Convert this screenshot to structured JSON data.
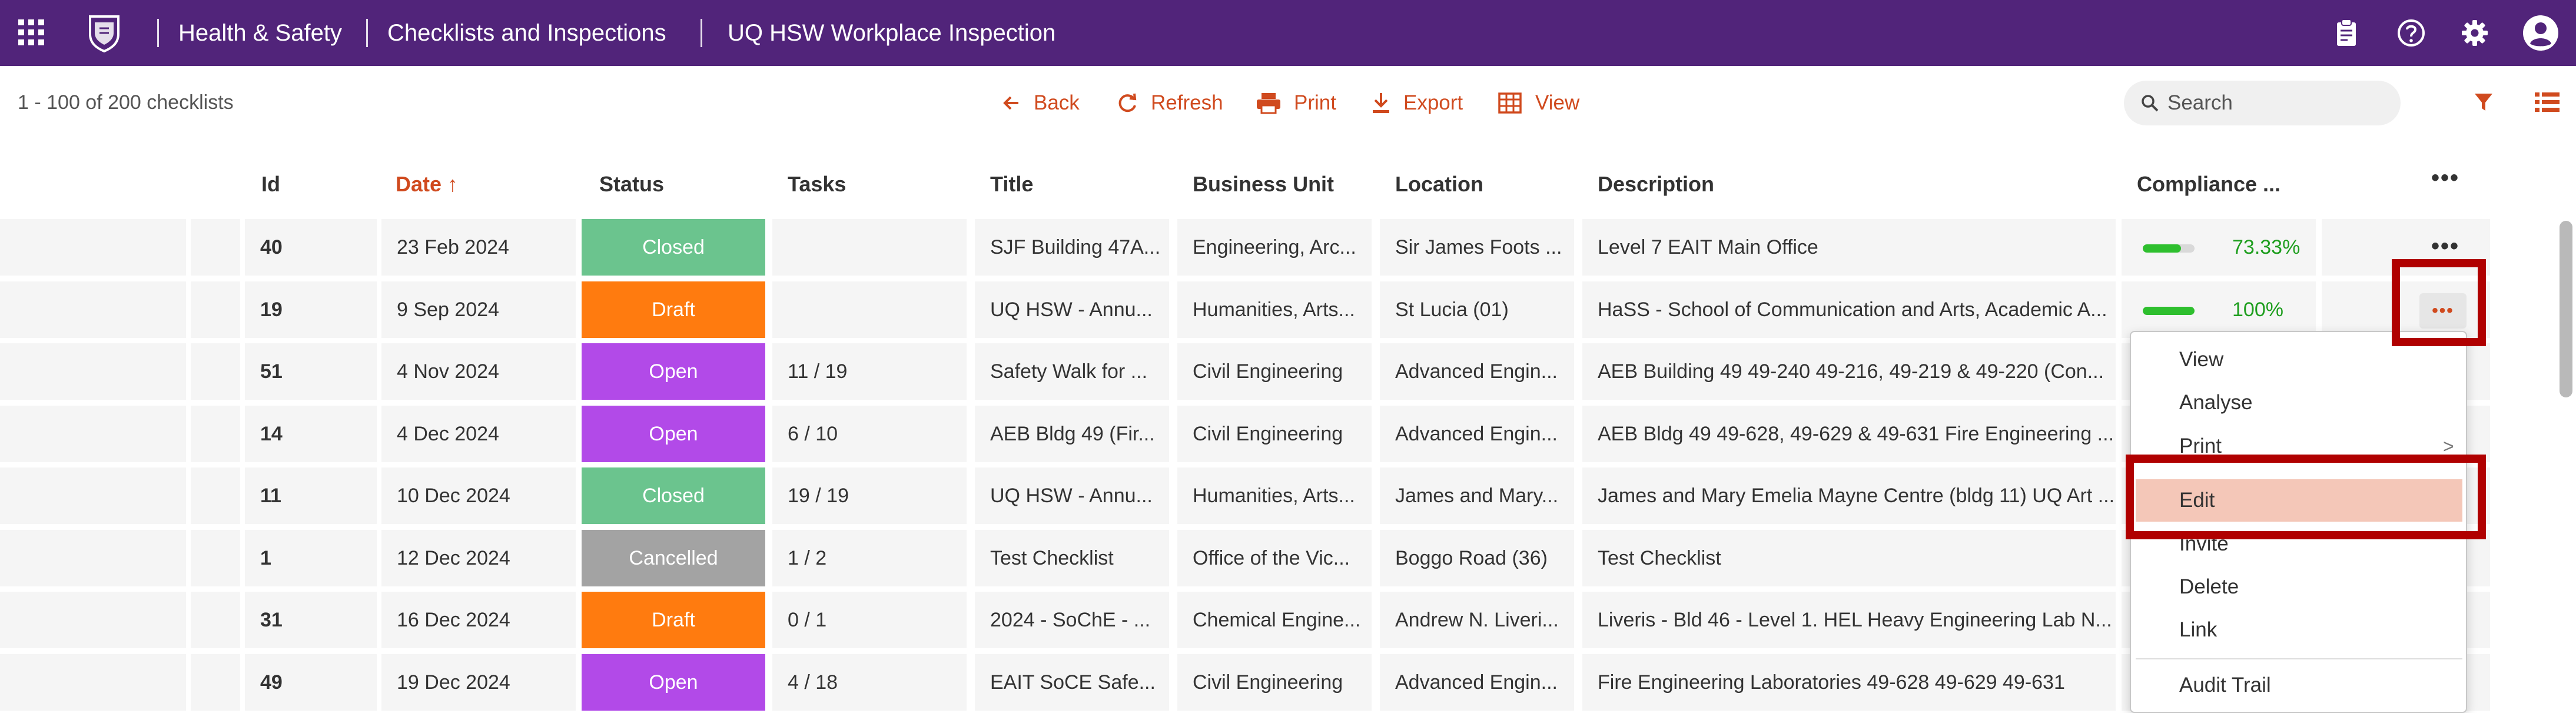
{
  "header": {
    "breadcrumbs": [
      "Health & Safety",
      "Checklists and Inspections",
      "UQ HSW Workplace Inspection"
    ]
  },
  "toolbar": {
    "count_text": "1 - 100 of 200 checklists",
    "back": "Back",
    "refresh": "Refresh",
    "print": "Print",
    "export": "Export",
    "view": "View",
    "search_placeholder": "Search"
  },
  "table": {
    "columns": {
      "id": "Id",
      "date": "Date ↑",
      "status": "Status",
      "tasks": "Tasks",
      "title": "Title",
      "business_unit": "Business Unit",
      "location": "Location",
      "description": "Description",
      "compliance": "Compliance ..."
    },
    "rows": [
      {
        "id": "40",
        "date": "23 Feb 2024",
        "status": "Closed",
        "status_key": "closed",
        "tasks": "",
        "title": "SJF Building 47A...",
        "business_unit": "Engineering, Arc...",
        "location": "Sir James Foots ...",
        "description": "Level 7 EAIT Main Office",
        "compliance": "73.33%",
        "compliance_value": 0.7333
      },
      {
        "id": "19",
        "date": "9 Sep 2024",
        "status": "Draft",
        "status_key": "draft",
        "tasks": "",
        "title": "UQ HSW - Annu...",
        "business_unit": "Humanities, Arts...",
        "location": "St Lucia (01)",
        "description": "HaSS - School of Communication and Arts, Academic A...",
        "compliance": "100%",
        "compliance_value": 1.0
      },
      {
        "id": "51",
        "date": "4 Nov 2024",
        "status": "Open",
        "status_key": "open",
        "tasks": "11 / 19",
        "title": "Safety Walk for ...",
        "business_unit": "Civil Engineering",
        "location": "Advanced Engin...",
        "description": "AEB Building 49 49-240 49-216, 49-219 & 49-220 (Con...",
        "compliance": "",
        "compliance_value": null
      },
      {
        "id": "14",
        "date": "4 Dec 2024",
        "status": "Open",
        "status_key": "open",
        "tasks": "6 / 10",
        "title": "AEB Bldg 49 (Fir...",
        "business_unit": "Civil Engineering",
        "location": "Advanced Engin...",
        "description": "AEB Bldg 49 49-628, 49-629 & 49-631 Fire Engineering ...",
        "compliance": "",
        "compliance_value": null
      },
      {
        "id": "11",
        "date": "10 Dec 2024",
        "status": "Closed",
        "status_key": "closed",
        "tasks": "19 / 19",
        "title": "UQ HSW - Annu...",
        "business_unit": "Humanities, Arts...",
        "location": "James and Mary...",
        "description": "James and Mary Emelia Mayne Centre (bldg 11) UQ Art ...",
        "compliance": "",
        "compliance_value": null
      },
      {
        "id": "1",
        "date": "12 Dec 2024",
        "status": "Cancelled",
        "status_key": "cancelled",
        "tasks": "1 / 2",
        "title": "Test Checklist",
        "business_unit": "Office of the Vic...",
        "location": "Boggo Road (36)",
        "description": "Test Checklist",
        "compliance": "",
        "compliance_value": null
      },
      {
        "id": "31",
        "date": "16 Dec 2024",
        "status": "Draft",
        "status_key": "draft",
        "tasks": "0 / 1",
        "title": "2024 - SoChE - ...",
        "business_unit": "Chemical Engine...",
        "location": "Andrew N. Liveri...",
        "description": "Liveris - Bld 46 - Level 1. HEL Heavy Engineering Lab N...",
        "compliance": "",
        "compliance_value": null
      },
      {
        "id": "49",
        "date": "19 Dec 2024",
        "status": "Open",
        "status_key": "open",
        "tasks": "4 / 18",
        "title": "EAIT SoCE Safe...",
        "business_unit": "Civil Engineering",
        "location": "Advanced Engin...",
        "description": "Fire Engineering Laboratories 49-628 49-629 49-631",
        "compliance": "",
        "compliance_value": null
      }
    ]
  },
  "context_menu": {
    "items": [
      "View",
      "Analyse",
      "Print",
      "Edit",
      "Invite",
      "Delete",
      "Link",
      "Audit Trail"
    ],
    "active": "Edit"
  },
  "colors": {
    "header_bg": "#51247a",
    "accent": "#d04a1e",
    "closed": "#6bc48e",
    "draft": "#ff7b0f",
    "open": "#b24ae8",
    "cancelled": "#a3a3a3",
    "highlight": "#b00000"
  }
}
